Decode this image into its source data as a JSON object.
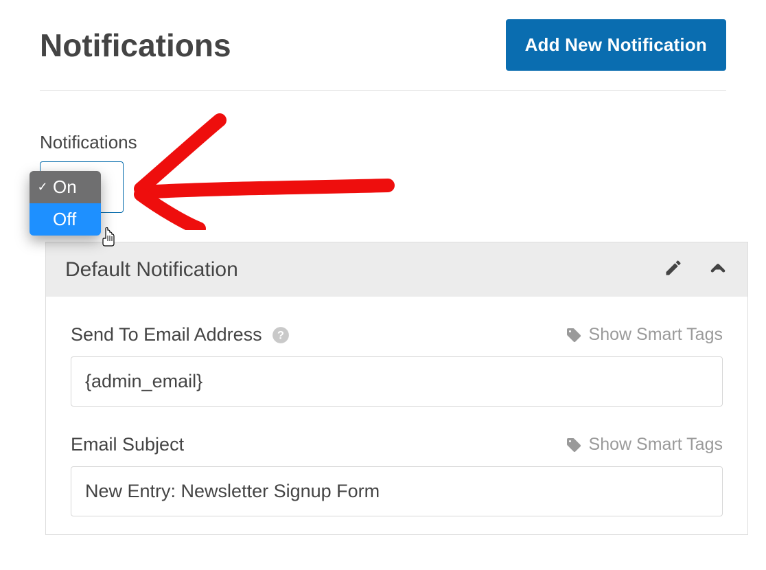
{
  "header": {
    "title": "Notifications",
    "add_button": "Add New Notification"
  },
  "toggle": {
    "section_label": "Notifications",
    "options": {
      "on": "On",
      "off": "Off"
    },
    "selected": "On",
    "hovered": "Off"
  },
  "panel": {
    "title": "Default Notification",
    "fields": {
      "send_to": {
        "label": "Send To Email Address",
        "smart_tags_label": "Show Smart Tags",
        "value": "{admin_email}"
      },
      "subject": {
        "label": "Email Subject",
        "smart_tags_label": "Show Smart Tags",
        "value": "New Entry: Newsletter Signup Form"
      }
    }
  },
  "annotation": {
    "type": "hand-drawn-arrow",
    "color": "#ee0e0d",
    "points_to": "toggle-dropdown"
  }
}
